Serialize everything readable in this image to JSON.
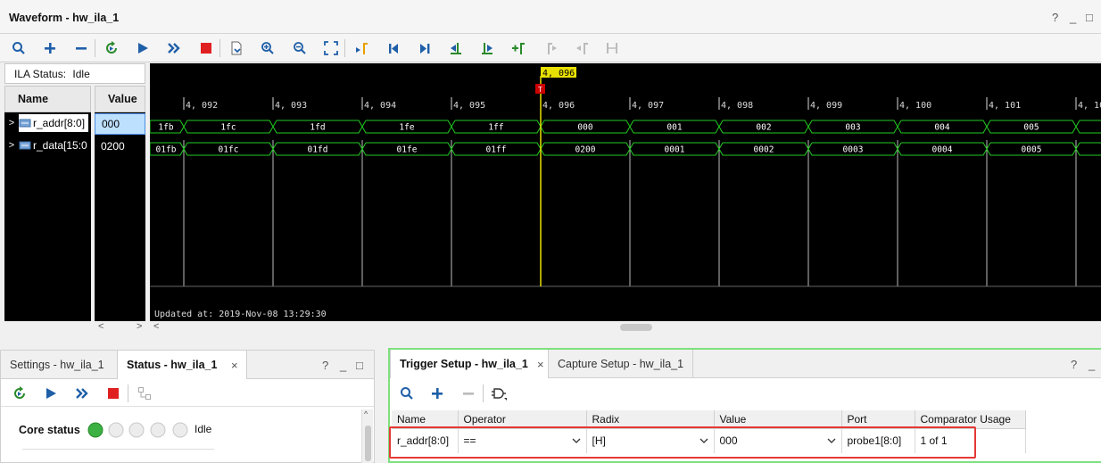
{
  "waveform": {
    "title": "Waveform - hw_ila_1",
    "window_controls": [
      "?",
      "_",
      "□"
    ],
    "toolbar_icons": [
      "search-icon",
      "add-icon",
      "remove-icon",
      "refresh-run-icon",
      "run-icon",
      "run-immediate-icon",
      "stop-icon",
      "export-icon",
      "zoom-in-icon",
      "zoom-out-icon",
      "zoom-fit-icon",
      "marker-add-icon",
      "go-first-icon",
      "go-last-icon",
      "prev-transition-icon",
      "next-transition-icon",
      "add-marker-icon",
      "prev-marker-icon",
      "next-marker-icon",
      "swap-cursors-icon"
    ],
    "ila_status_label": "ILA Status:",
    "ila_status_value": "Idle",
    "name_header": "Name",
    "value_header": "Value",
    "signals": [
      {
        "expand": ">",
        "name": "r_addr[8:0]",
        "value": "000",
        "selected": true
      },
      {
        "expand": ">",
        "name": "r_data[15:0",
        "value": "0200",
        "selected": false
      }
    ],
    "cursor_label": "4, 096",
    "time_ticks": [
      "4, 092",
      "4, 093",
      "4, 094",
      "4, 095",
      "4, 096",
      "4, 097",
      "4, 098",
      "4, 099",
      "4, 100",
      "4, 101",
      "4, 10"
    ],
    "bus_addr": [
      "1fb",
      "1fc",
      "1fd",
      "1fe",
      "1ff",
      "000",
      "001",
      "002",
      "003",
      "004",
      "005",
      "006"
    ],
    "bus_data": [
      "01fb",
      "01fc",
      "01fd",
      "01fe",
      "01ff",
      "0200",
      "0001",
      "0002",
      "0003",
      "0004",
      "0005",
      "0006"
    ],
    "updated_text": "Updated at: 2019-Nov-08 13:29:30",
    "colors": {
      "wave": "#22cc22",
      "cursor": "#e8e000",
      "trigger_marker": "#cc0000",
      "background": "#000000"
    }
  },
  "status_panel": {
    "tabs": [
      {
        "label": "Settings - hw_ila_1",
        "active": false
      },
      {
        "label": "Status - hw_ila_1",
        "active": true
      }
    ],
    "close": "×",
    "window_controls": [
      "?",
      "_",
      "□"
    ],
    "core_status_label": "Core status",
    "core_status_value": "Idle",
    "status_colors": {
      "active": "#3cb043",
      "inactive": "#e0e0e0"
    }
  },
  "trigger_panel": {
    "tabs": [
      {
        "label": "Trigger Setup - hw_ila_1",
        "active": true
      },
      {
        "label": "Capture Setup - hw_ila_1",
        "active": false
      }
    ],
    "close": "×",
    "window_controls": [
      "?",
      "_"
    ],
    "columns": [
      "Name",
      "Operator",
      "Radix",
      "Value",
      "Port",
      "Comparator Usage"
    ],
    "row": {
      "name": "r_addr[8:0]",
      "operator": "==",
      "radix": "[H]",
      "value": "000",
      "port": "probe1[8:0]",
      "usage": "1 of 1"
    },
    "highlight_color": "#e53935",
    "panel_border_color": "#7ee07e"
  }
}
